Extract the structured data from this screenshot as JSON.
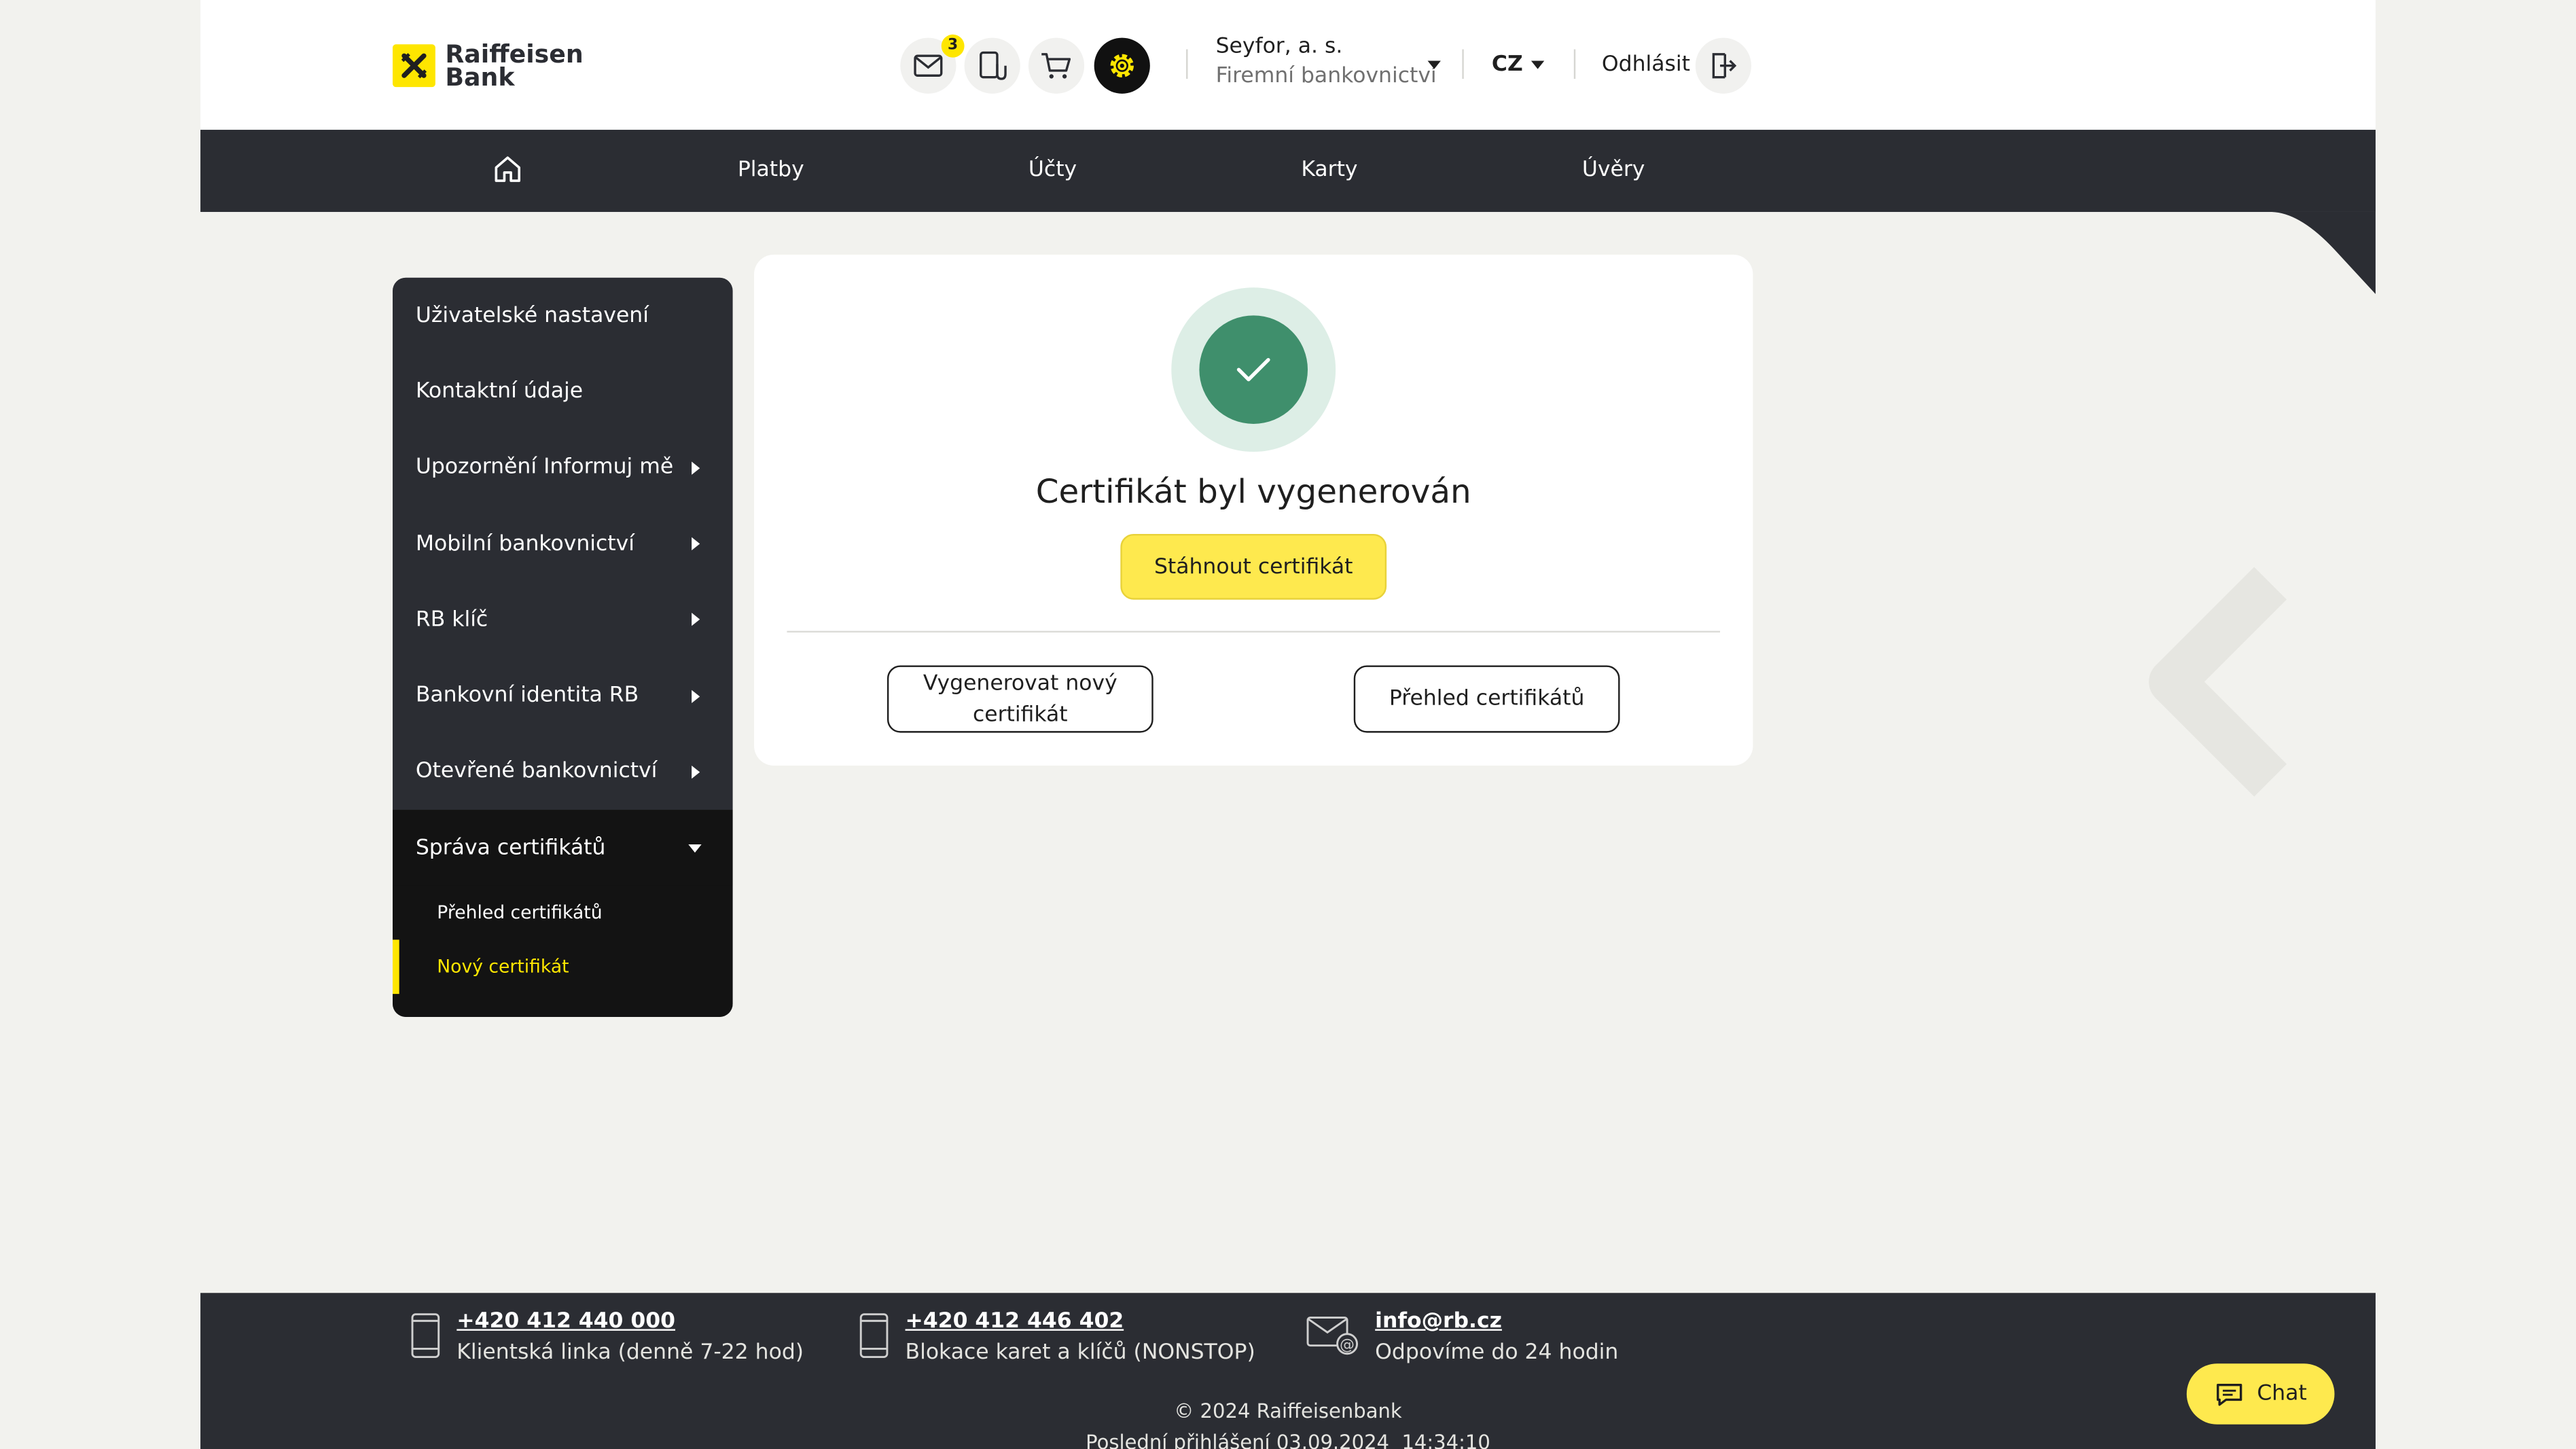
{
  "brand": {
    "logo_line1": "Raiffeisen",
    "logo_line2": "Bank",
    "accent": "#fee600",
    "dark": "#2b2d33"
  },
  "header": {
    "messages_badge": "3",
    "company_name": "Seyfor, a. s.",
    "company_sub": "Firemní bankovnictví",
    "language": "CZ",
    "logout_label": "Odhlásit",
    "icons": [
      "mail-icon",
      "documents-icon",
      "cart-icon",
      "settings-icon",
      "logout-icon"
    ]
  },
  "nav": {
    "items": [
      "Platby",
      "Účty",
      "Karty",
      "Úvěry"
    ]
  },
  "sidebar": {
    "items": [
      {
        "label": "Uživatelské nastavení"
      },
      {
        "label": "Kontaktní údaje"
      },
      {
        "label": "Upozornění Informuj mě"
      },
      {
        "label": "Mobilní bankovnictví"
      },
      {
        "label": "RB klíč"
      },
      {
        "label": "Bankovní identita RB"
      },
      {
        "label": "Otevřené bankovnictví"
      },
      {
        "label": "Správa certifikátů"
      }
    ],
    "subitems": [
      {
        "label": "Přehled certifikátů"
      },
      {
        "label": "Nový certifikát"
      }
    ]
  },
  "card": {
    "title": "Certifikát byl vygenerován",
    "download_label": "Stáhnout certifikát",
    "generate_new_label": "Vygenerovat nový certifikát",
    "overview_label": "Přehled certifikátů",
    "success_color": "#3f8f6c"
  },
  "footer": {
    "contacts": [
      {
        "link": "+420 412 440 000",
        "desc": "Klientská linka (denně 7-22 hod)"
      },
      {
        "link": "+420 412 446 402",
        "desc": "Blokace karet a klíčů (NONSTOP)"
      },
      {
        "link": "info@rb.cz",
        "desc": "Odpovíme do 24 hodin"
      }
    ],
    "copyright": "© 2024 Raiffeisenbank",
    "last_login": "Poslední přihlášení 03.09.2024  14:34:10",
    "chat_label": "Chat"
  }
}
